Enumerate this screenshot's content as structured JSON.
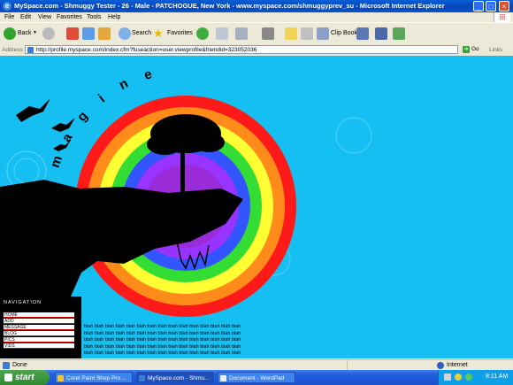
{
  "window": {
    "title": "MySpace.com - Shmuggy Tester - 26 - Male - PATCHOGUE, New York - www.myspace.com/shmuggyprev_su - Microsoft Internet Explorer",
    "app_icon": "ie-icon",
    "controls": [
      "minimize",
      "maximize",
      "close"
    ]
  },
  "menubar": {
    "items": [
      "File",
      "Edit",
      "View",
      "Favorites",
      "Tools",
      "Help"
    ]
  },
  "toolbar": {
    "back_label": "Back",
    "search_label": "Search",
    "favorites_label": "Favorites",
    "clipbook_label": "Clip Book"
  },
  "addressbar": {
    "label": "Address",
    "url": "http://profile.myspace.com/index.cfm?fuseaction=user.viewprofile&friendid=323052036",
    "go_label": "Go",
    "links_label": "Links"
  },
  "page": {
    "heading": "imagine",
    "nav_title": "NAVIGATION",
    "nav_items": [
      "HOME",
      "ADD",
      "MESSAGE",
      "BLOG",
      "PICS",
      "VIDS"
    ],
    "blah_lines": [
      "blah blah blah blah blah blah blah blah blah blah blah blah blah blah blah",
      "blah blah blah blah blah blah blah blah blah blah blah blah blah blah blah",
      "blah blah blah blah blah blah blah blah blah blah blah blah blah blah blah",
      "blah blah blah blah blah blah blah blah blah blah blah blah blah blah blah",
      "blah blah blah blah blah blah blah blah blah blah blah blah blah blah blah"
    ],
    "colors": {
      "background": "#15bff2",
      "rainbow": [
        "#ff1a1a",
        "#ff8c1a",
        "#ffff33",
        "#33dd33",
        "#3355ff",
        "#9933ff"
      ]
    }
  },
  "statusbar": {
    "status": "Done",
    "zone": "Internet"
  },
  "taskbar": {
    "start_label": "start",
    "tasks": [
      "Corel Paint Shop Pro ...",
      "MySpace.com - Shmu...",
      "Document - WordPad"
    ],
    "clock": "8:11 AM"
  }
}
